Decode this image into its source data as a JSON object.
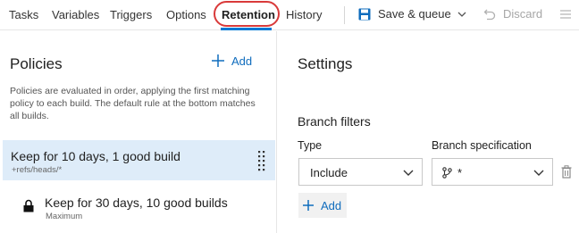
{
  "toolbar": {
    "tabs": [
      {
        "label": "Tasks"
      },
      {
        "label": "Variables"
      },
      {
        "label": "Triggers"
      },
      {
        "label": "Options"
      },
      {
        "label": "Retention",
        "active": true
      },
      {
        "label": "History"
      }
    ],
    "save_queue_label": "Save & queue",
    "discard_label": "Discard"
  },
  "left_panel": {
    "title": "Policies",
    "add_label": "Add",
    "description": "Policies are evaluated in order, applying the first matching policy to each build. The default rule at the bottom matches all builds.",
    "policies": [
      {
        "title": "Keep for 10 days, 1 good build",
        "subtitle": "+refs/heads/*",
        "selected": true
      },
      {
        "title": "Keep for 30 days, 10 good builds",
        "subtitle": "Maximum",
        "locked": true
      }
    ]
  },
  "right_panel": {
    "title": "Settings",
    "branch_filters_title": "Branch filters",
    "type_label": "Type",
    "spec_label": "Branch specification",
    "type_value": "Include",
    "spec_value": "*",
    "add_label": "Add"
  },
  "colors": {
    "accent": "#0078d4",
    "link": "#0f6cbd",
    "selected_row": "#deecf9",
    "highlight_ring": "#d93a3a"
  },
  "icons": [
    "save-icon",
    "chevron-down-icon",
    "undo-icon",
    "menu-icon",
    "plus-icon",
    "grip-icon",
    "lock-icon",
    "branch-icon",
    "trash-icon"
  ]
}
